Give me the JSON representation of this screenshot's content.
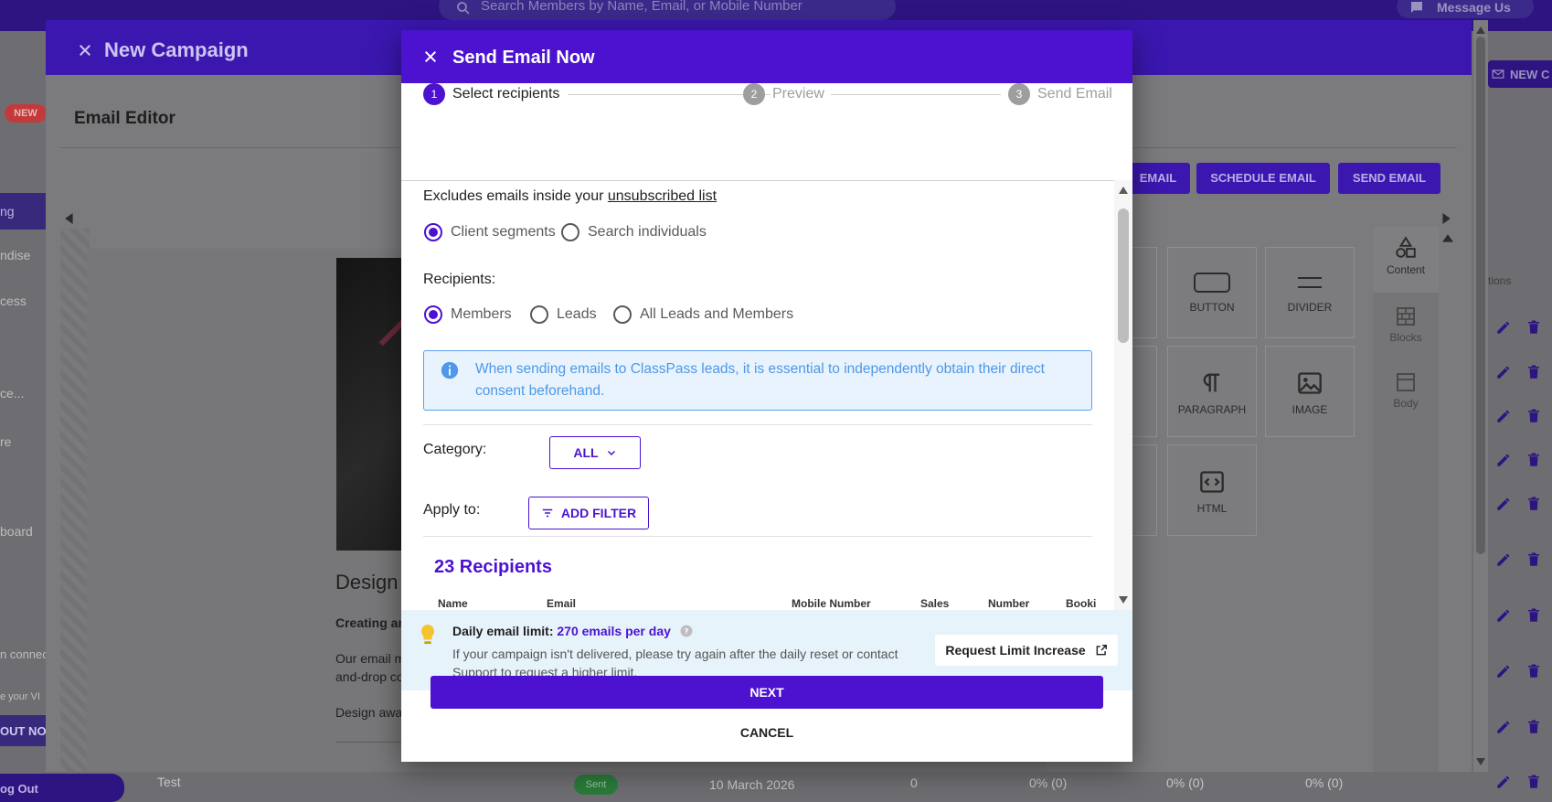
{
  "topbar": {
    "search_placeholder": "Search Members by Name, Email, or Mobile Number",
    "message_us": "Message Us"
  },
  "sidebar": {
    "new_badge": "NEW",
    "items": [
      "ng",
      "ndise",
      "cess",
      "ce...",
      "re",
      "board"
    ],
    "connect_text": "n connec",
    "vip_text": "e your VI",
    "out_btn": "OUT NO",
    "logout": "og Out"
  },
  "background": {
    "new_campaign_btn": "NEW C",
    "options_header": "tions",
    "row": {
      "name": "Test",
      "status": "Sent",
      "date": "10 March 2026",
      "count": "0",
      "pct1": "0% (0)",
      "pct2": "0% (0)",
      "pct3": "0% (0)"
    }
  },
  "campaign": {
    "title": "New Campaign",
    "editor_title": "Email Editor",
    "buttons": {
      "test_email": "EMAIL",
      "schedule": "SCHEDULE EMAIL",
      "send": "SEND EMAIL"
    },
    "canvas": {
      "heading": "Design",
      "bold_line": "Creating an",
      "para1a": "Our email m",
      "para1b": "and-drop co",
      "para2": "Design awa"
    },
    "tools": [
      {
        "label": "S",
        "icon": "button-icon"
      },
      {
        "label": "BUTTON",
        "icon": "button-icon"
      },
      {
        "label": "DIVIDER",
        "icon": "divider-icon"
      },
      {
        "label": "G",
        "icon": "heading-icon"
      },
      {
        "label": "PARAGRAPH",
        "icon": "paragraph-icon"
      },
      {
        "label": "IMAGE",
        "icon": "image-icon"
      },
      {
        "label": "HTML",
        "icon": "code-icon"
      }
    ],
    "side_tabs": [
      "Content",
      "Blocks",
      "Body"
    ]
  },
  "dialog": {
    "title": "Send Email Now",
    "steps": [
      {
        "num": "1",
        "label": "Select recipients"
      },
      {
        "num": "2",
        "label": "Preview"
      },
      {
        "num": "3",
        "label": "Send Email"
      }
    ],
    "excludes_prefix": "Excludes emails inside your",
    "unsubscribed_link": "unsubscribed list",
    "mode_options": {
      "segments": "Client segments",
      "individuals": "Search individuals"
    },
    "recipients_label": "Recipients:",
    "recipient_options": {
      "members": "Members",
      "leads": "Leads",
      "all": "All Leads and Members"
    },
    "info_text": "When sending emails to ClassPass leads, it is essential to independently obtain their direct consent beforehand.",
    "category_label": "Category:",
    "category_value": "ALL",
    "apply_label": "Apply to:",
    "add_filter": "ADD FILTER",
    "recipients_count": "23 Recipients",
    "table_headers": [
      "Name",
      "Email",
      "Mobile Number",
      "Sales",
      "Number",
      "Booki"
    ],
    "limit": {
      "label": "Daily email limit:",
      "value": "270 emails per day",
      "desc": "If your campaign isn't delivered, please try again after the daily reset or contact Support to request a higher limit.",
      "request_btn": "Request Limit Increase"
    },
    "next_btn": "NEXT",
    "cancel_btn": "CANCEL"
  },
  "colors": {
    "primary": "#4c12d0",
    "info_text": "#4d98e8",
    "info_bg": "#e9f3fd",
    "limit_bg": "#e7f3fb"
  }
}
